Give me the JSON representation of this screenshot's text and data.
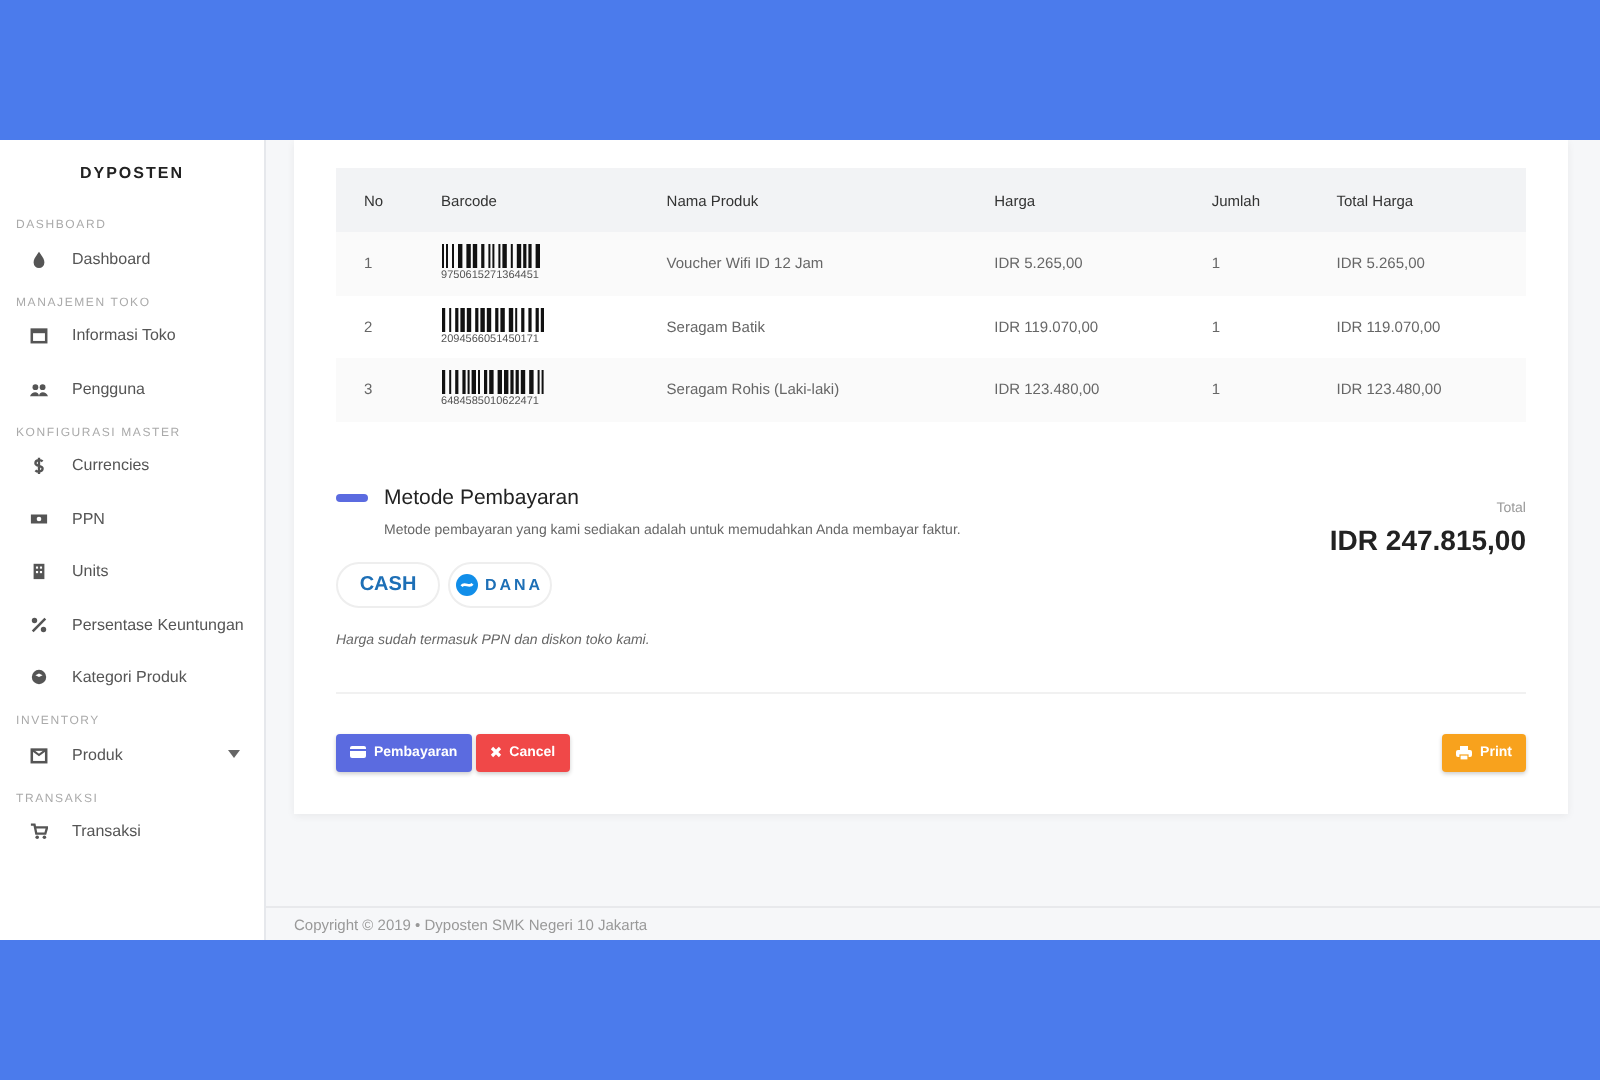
{
  "sidebar": {
    "brand": "DYPOSTEN",
    "sections": [
      {
        "heading": "DASHBOARD",
        "items": [
          {
            "label": "Dashboard"
          }
        ]
      },
      {
        "heading": "MANAJEMEN TOKO",
        "items": [
          {
            "label": "Informasi Toko"
          },
          {
            "label": "Pengguna"
          }
        ]
      },
      {
        "heading": "KONFIGURASI MASTER",
        "items": [
          {
            "label": "Currencies"
          },
          {
            "label": "PPN"
          },
          {
            "label": "Units"
          },
          {
            "label": "Persentase Keuntungan"
          },
          {
            "label": "Kategori Produk"
          }
        ]
      },
      {
        "heading": "INVENTORY",
        "items": [
          {
            "label": "Produk",
            "expanded": false
          }
        ]
      },
      {
        "heading": "TRANSAKSI",
        "items": [
          {
            "label": "Transaksi"
          }
        ]
      }
    ]
  },
  "table": {
    "columns": [
      "No",
      "Barcode",
      "Nama Produk",
      "Harga",
      "Jumlah",
      "Total Harga"
    ],
    "rows": [
      {
        "no": "1",
        "barcode": "9750615271364451",
        "name": "Voucher Wifi ID 12 Jam",
        "price": "IDR 5.265,00",
        "qty": "1",
        "total": "IDR 5.265,00"
      },
      {
        "no": "2",
        "barcode": "2094566051450171",
        "name": "Seragam Batik",
        "price": "IDR 119.070,00",
        "qty": "1",
        "total": "IDR 119.070,00"
      },
      {
        "no": "3",
        "barcode": "6484585010622471",
        "name": "Seragam Rohis (Laki-laki)",
        "price": "IDR 123.480,00",
        "qty": "1",
        "total": "IDR 123.480,00"
      }
    ]
  },
  "payment": {
    "title": "Metode Pembayaran",
    "description": "Metode pembayaran yang kami sediakan adalah untuk memudahkan Anda membayar faktur.",
    "methods": [
      {
        "kind": "cash",
        "label": "CASH"
      },
      {
        "kind": "dana",
        "label": "DANA"
      }
    ],
    "note": "Harga sudah termasuk PPN dan diskon toko kami."
  },
  "total": {
    "label": "Total",
    "amount": "IDR 247.815,00"
  },
  "buttons": [
    {
      "kind": "pay",
      "label": "Pembayaran"
    },
    {
      "kind": "cancel",
      "label": "Cancel"
    },
    {
      "kind": "print",
      "label": "Print"
    }
  ],
  "footer": "Copyright © 2019 • Dyposten SMK Negeri 10 Jakarta"
}
